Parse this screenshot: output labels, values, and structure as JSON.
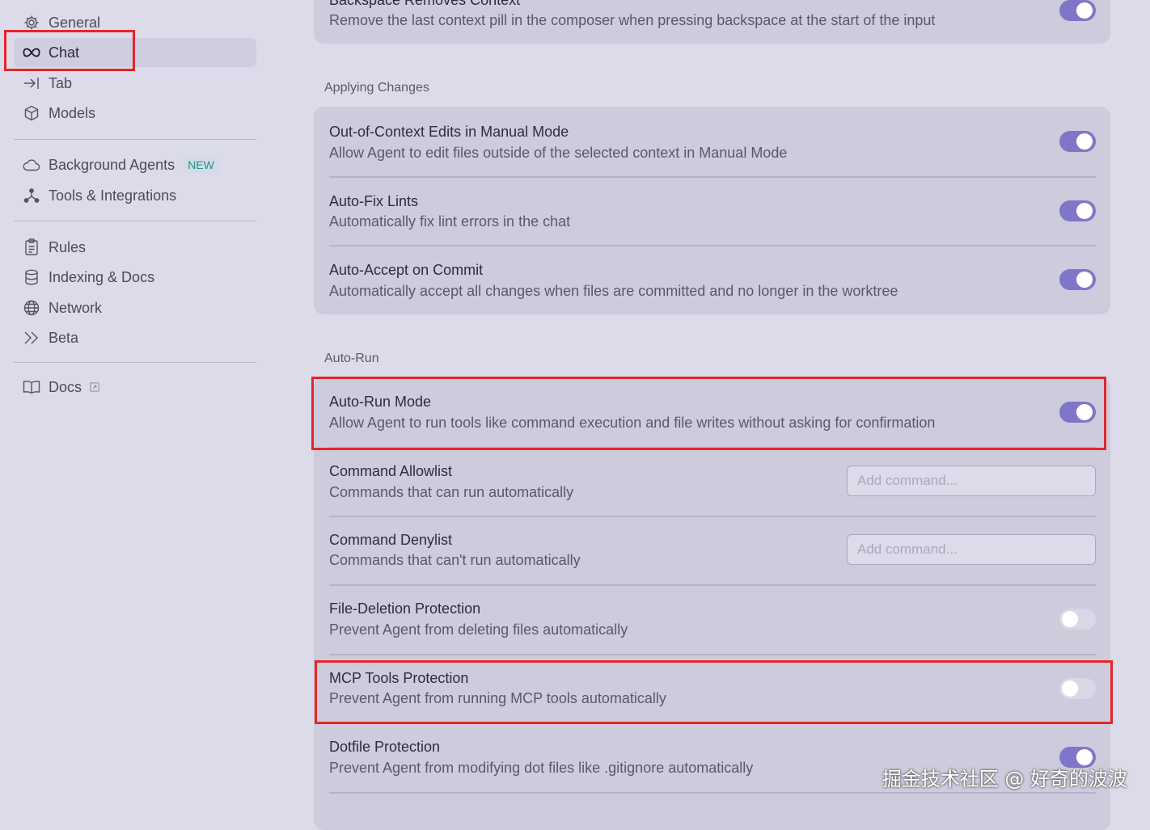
{
  "sidebar": {
    "items": [
      {
        "label": "General",
        "icon": "gear-icon"
      },
      {
        "label": "Chat",
        "icon": "infinity-icon"
      },
      {
        "label": "Tab",
        "icon": "arrow-right-bar-icon"
      },
      {
        "label": "Models",
        "icon": "cube-icon"
      },
      {
        "label": "Background Agents",
        "icon": "cloud-icon",
        "badge": "NEW"
      },
      {
        "label": "Tools & Integrations",
        "icon": "nodes-icon"
      },
      {
        "label": "Rules",
        "icon": "clipboard-icon"
      },
      {
        "label": "Indexing & Docs",
        "icon": "database-icon"
      },
      {
        "label": "Network",
        "icon": "globe-icon"
      },
      {
        "label": "Beta",
        "icon": "double-chevron-icon"
      },
      {
        "label": "Docs",
        "icon": "book-icon"
      }
    ]
  },
  "main": {
    "top_row": {
      "title": "Backspace Removes Context",
      "desc": "Remove the last context pill in the composer when pressing backspace at the start of the input",
      "enabled": true
    },
    "applying_changes": {
      "heading": "Applying Changes",
      "rows": [
        {
          "title": "Out-of-Context Edits in Manual Mode",
          "desc": "Allow Agent to edit files outside of the selected context in Manual Mode",
          "enabled": true
        },
        {
          "title": "Auto-Fix Lints",
          "desc": "Automatically fix lint errors in the chat",
          "enabled": true
        },
        {
          "title": "Auto-Accept on Commit",
          "desc": "Automatically accept all changes when files are committed and no longer in the worktree",
          "enabled": true
        }
      ]
    },
    "auto_run": {
      "heading": "Auto-Run",
      "rows": [
        {
          "title": "Auto-Run Mode",
          "desc": "Allow Agent to run tools like command execution and file writes without asking for confirmation",
          "enabled": true
        },
        {
          "title": "Command Allowlist",
          "desc": "Commands that can run automatically",
          "placeholder": "Add command..."
        },
        {
          "title": "Command Denylist",
          "desc": "Commands that can't run automatically",
          "placeholder": "Add command..."
        },
        {
          "title": "File-Deletion Protection",
          "desc": "Prevent Agent from deleting files automatically",
          "enabled": false
        },
        {
          "title": "MCP Tools Protection",
          "desc": "Prevent Agent from running MCP tools automatically",
          "enabled": false
        },
        {
          "title": "Dotfile Protection",
          "desc": "Prevent Agent from modifying dot files like .gitignore automatically",
          "enabled": true
        }
      ]
    }
  },
  "watermark": "掘金技术社区 @ 好奇的波波",
  "colors": {
    "accent": "#8076c9",
    "highlight": "#e3262a",
    "badge": "#27928a"
  }
}
